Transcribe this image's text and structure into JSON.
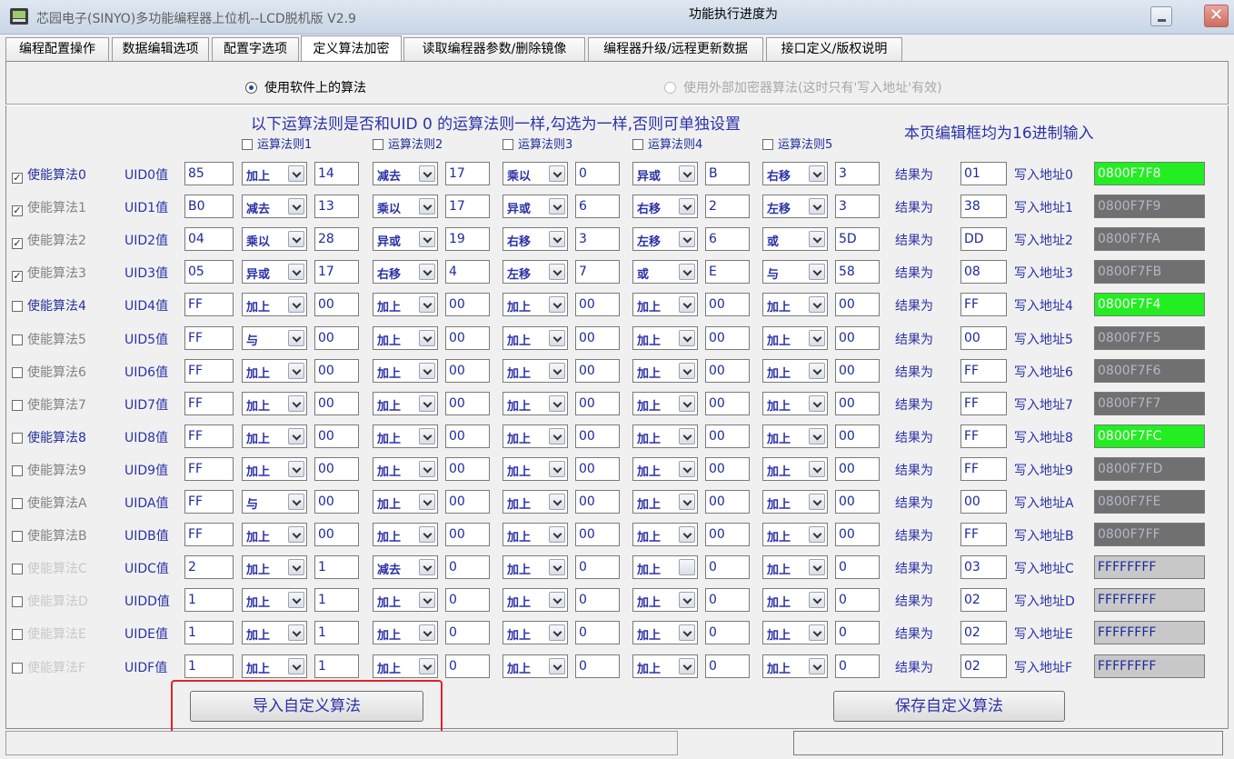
{
  "window": {
    "title": "芯园电子(SINYO)多功能编程器上位机--LCD脱机版 V2.9",
    "close_symbol": "✕"
  },
  "tabs": [
    {
      "label": "编程配置操作",
      "active": false
    },
    {
      "label": "数据编辑选项",
      "active": false
    },
    {
      "label": "配置字选项",
      "active": false
    },
    {
      "label": "定义算法加密",
      "active": true
    },
    {
      "label": "读取编程器参数/删除镜像",
      "active": false
    },
    {
      "label": "编程器升级/远程更新数据",
      "active": false
    },
    {
      "label": "接口定义/版权说明",
      "active": false
    }
  ],
  "algorithm_source": {
    "software_label": "使用软件上的算法",
    "software_selected": true,
    "external_label": "使用外部加密器算法(这时只有'写入地址'有效)",
    "external_selected": false
  },
  "heading": "以下运算法则是否和UID 0 的运算法则一样,勾选为一样,否则可单独设置",
  "hex_note": "本页编辑框均为16进制输入",
  "rule_headers": [
    "运算法则1",
    "运算法则2",
    "运算法则3",
    "运算法则4",
    "运算法则5"
  ],
  "result_label": "结果为",
  "rows": [
    {
      "enable_label": "使能算法0",
      "checked": true,
      "state": "on",
      "uid_label": "UID0值",
      "uid_value": "85",
      "ops": [
        {
          "op": "加上",
          "val": "14"
        },
        {
          "op": "减去",
          "val": "17"
        },
        {
          "op": "乘以",
          "val": "0"
        },
        {
          "op": "异或",
          "val": "B"
        },
        {
          "op": "右移",
          "val": "3"
        }
      ],
      "result": "01",
      "addr_label": "写入地址0",
      "addr": "0800F7F8",
      "addr_style": "green"
    },
    {
      "enable_label": "使能算法1",
      "checked": true,
      "state": "off",
      "uid_label": "UID1值",
      "uid_value": "B0",
      "ops": [
        {
          "op": "减去",
          "val": "13"
        },
        {
          "op": "乘以",
          "val": "17"
        },
        {
          "op": "异或",
          "val": "6"
        },
        {
          "op": "右移",
          "val": "2"
        },
        {
          "op": "左移",
          "val": "3"
        }
      ],
      "result": "38",
      "addr_label": "写入地址1",
      "addr": "0800F7F9",
      "addr_style": "gray"
    },
    {
      "enable_label": "使能算法2",
      "checked": true,
      "state": "off",
      "uid_label": "UID2值",
      "uid_value": "04",
      "ops": [
        {
          "op": "乘以",
          "val": "28"
        },
        {
          "op": "异或",
          "val": "19"
        },
        {
          "op": "右移",
          "val": "3"
        },
        {
          "op": "左移",
          "val": "6"
        },
        {
          "op": "或",
          "val": "5D"
        }
      ],
      "result": "DD",
      "addr_label": "写入地址2",
      "addr": "0800F7FA",
      "addr_style": "gray"
    },
    {
      "enable_label": "使能算法3",
      "checked": true,
      "state": "off",
      "uid_label": "UID3值",
      "uid_value": "05",
      "ops": [
        {
          "op": "异或",
          "val": "17"
        },
        {
          "op": "右移",
          "val": "4"
        },
        {
          "op": "左移",
          "val": "7"
        },
        {
          "op": "或",
          "val": "E"
        },
        {
          "op": "与",
          "val": "58"
        }
      ],
      "result": "08",
      "addr_label": "写入地址3",
      "addr": "0800F7FB",
      "addr_style": "gray"
    },
    {
      "enable_label": "使能算法4",
      "checked": false,
      "state": "on",
      "uid_label": "UID4值",
      "uid_value": "FF",
      "ops": [
        {
          "op": "加上",
          "val": "00"
        },
        {
          "op": "加上",
          "val": "00"
        },
        {
          "op": "加上",
          "val": "00"
        },
        {
          "op": "加上",
          "val": "00"
        },
        {
          "op": "加上",
          "val": "00"
        }
      ],
      "result": "FF",
      "addr_label": "写入地址4",
      "addr": "0800F7F4",
      "addr_style": "green"
    },
    {
      "enable_label": "使能算法5",
      "checked": false,
      "state": "off",
      "uid_label": "UID5值",
      "uid_value": "FF",
      "ops": [
        {
          "op": "与",
          "val": "00"
        },
        {
          "op": "加上",
          "val": "00"
        },
        {
          "op": "加上",
          "val": "00"
        },
        {
          "op": "加上",
          "val": "00"
        },
        {
          "op": "加上",
          "val": "00"
        }
      ],
      "result": "00",
      "addr_label": "写入地址5",
      "addr": "0800F7F5",
      "addr_style": "gray"
    },
    {
      "enable_label": "使能算法6",
      "checked": false,
      "state": "off",
      "uid_label": "UID6值",
      "uid_value": "FF",
      "ops": [
        {
          "op": "加上",
          "val": "00"
        },
        {
          "op": "加上",
          "val": "00"
        },
        {
          "op": "加上",
          "val": "00"
        },
        {
          "op": "加上",
          "val": "00"
        },
        {
          "op": "加上",
          "val": "00"
        }
      ],
      "result": "FF",
      "addr_label": "写入地址6",
      "addr": "0800F7F6",
      "addr_style": "gray"
    },
    {
      "enable_label": "使能算法7",
      "checked": false,
      "state": "off",
      "uid_label": "UID7值",
      "uid_value": "FF",
      "ops": [
        {
          "op": "加上",
          "val": "00"
        },
        {
          "op": "加上",
          "val": "00"
        },
        {
          "op": "加上",
          "val": "00"
        },
        {
          "op": "加上",
          "val": "00"
        },
        {
          "op": "加上",
          "val": "00"
        }
      ],
      "result": "FF",
      "addr_label": "写入地址7",
      "addr": "0800F7F7",
      "addr_style": "gray"
    },
    {
      "enable_label": "使能算法8",
      "checked": false,
      "state": "on",
      "uid_label": "UID8值",
      "uid_value": "FF",
      "ops": [
        {
          "op": "加上",
          "val": "00"
        },
        {
          "op": "加上",
          "val": "00"
        },
        {
          "op": "加上",
          "val": "00"
        },
        {
          "op": "加上",
          "val": "00"
        },
        {
          "op": "加上",
          "val": "00"
        }
      ],
      "result": "FF",
      "addr_label": "写入地址8",
      "addr": "0800F7FC",
      "addr_style": "green"
    },
    {
      "enable_label": "使能算法9",
      "checked": false,
      "state": "off",
      "uid_label": "UID9值",
      "uid_value": "FF",
      "ops": [
        {
          "op": "加上",
          "val": "00"
        },
        {
          "op": "加上",
          "val": "00"
        },
        {
          "op": "加上",
          "val": "00"
        },
        {
          "op": "加上",
          "val": "00"
        },
        {
          "op": "加上",
          "val": "00"
        }
      ],
      "result": "FF",
      "addr_label": "写入地址9",
      "addr": "0800F7FD",
      "addr_style": "gray"
    },
    {
      "enable_label": "使能算法A",
      "checked": false,
      "state": "off",
      "uid_label": "UIDA值",
      "uid_value": "FF",
      "ops": [
        {
          "op": "与",
          "val": "00"
        },
        {
          "op": "加上",
          "val": "00"
        },
        {
          "op": "加上",
          "val": "00"
        },
        {
          "op": "加上",
          "val": "00"
        },
        {
          "op": "加上",
          "val": "00"
        }
      ],
      "result": "00",
      "addr_label": "写入地址A",
      "addr": "0800F7FE",
      "addr_style": "gray"
    },
    {
      "enable_label": "使能算法B",
      "checked": false,
      "state": "off",
      "uid_label": "UIDB值",
      "uid_value": "FF",
      "ops": [
        {
          "op": "加上",
          "val": "00"
        },
        {
          "op": "加上",
          "val": "00"
        },
        {
          "op": "加上",
          "val": "00"
        },
        {
          "op": "加上",
          "val": "00"
        },
        {
          "op": "加上",
          "val": "00"
        }
      ],
      "result": "FF",
      "addr_label": "写入地址B",
      "addr": "0800F7FF",
      "addr_style": "gray"
    },
    {
      "enable_label": "使能算法C",
      "checked": false,
      "state": "dis",
      "uid_label": "UIDC值",
      "uid_value": "2",
      "ops": [
        {
          "op": "加上",
          "val": "1"
        },
        {
          "op": "减去",
          "val": "0"
        },
        {
          "op": "加上",
          "val": "0"
        },
        {
          "op": "加上",
          "val": "0"
        },
        {
          "op": "加上",
          "val": "0"
        }
      ],
      "result": "03",
      "addr_label": "写入地址C",
      "addr": "FFFFFFFF",
      "addr_style": "light"
    },
    {
      "enable_label": "使能算法D",
      "checked": false,
      "state": "dis",
      "uid_label": "UIDD值",
      "uid_value": "1",
      "ops": [
        {
          "op": "加上",
          "val": "1"
        },
        {
          "op": "加上",
          "val": "0"
        },
        {
          "op": "加上",
          "val": "0"
        },
        {
          "op": "加上",
          "val": "0"
        },
        {
          "op": "加上",
          "val": "0"
        }
      ],
      "result": "02",
      "addr_label": "写入地址D",
      "addr": "FFFFFFFF",
      "addr_style": "light"
    },
    {
      "enable_label": "使能算法E",
      "checked": false,
      "state": "dis",
      "uid_label": "UIDE值",
      "uid_value": "1",
      "ops": [
        {
          "op": "加上",
          "val": "1"
        },
        {
          "op": "加上",
          "val": "0"
        },
        {
          "op": "加上",
          "val": "0"
        },
        {
          "op": "加上",
          "val": "0"
        },
        {
          "op": "加上",
          "val": "0"
        }
      ],
      "result": "02",
      "addr_label": "写入地址E",
      "addr": "FFFFFFFF",
      "addr_style": "light"
    },
    {
      "enable_label": "使能算法F",
      "checked": false,
      "state": "dis",
      "uid_label": "UIDF值",
      "uid_value": "1",
      "ops": [
        {
          "op": "加上",
          "val": "1"
        },
        {
          "op": "加上",
          "val": "0"
        },
        {
          "op": "加上",
          "val": "0"
        },
        {
          "op": "加上",
          "val": "0"
        },
        {
          "op": "加上",
          "val": "0"
        }
      ],
      "result": "02",
      "addr_label": "写入地址F",
      "addr": "FFFFFFFF",
      "addr_style": "light"
    }
  ],
  "buttons": {
    "import_label": "导入自定义算法",
    "save_label": "保存自定义算法"
  },
  "status": {
    "progress_label": "功能执行进度为"
  },
  "colors": {
    "label_blue": "#2b32a8",
    "address_green": "#22ee22",
    "address_gray": "#707070",
    "highlight_red": "#e0232b"
  }
}
